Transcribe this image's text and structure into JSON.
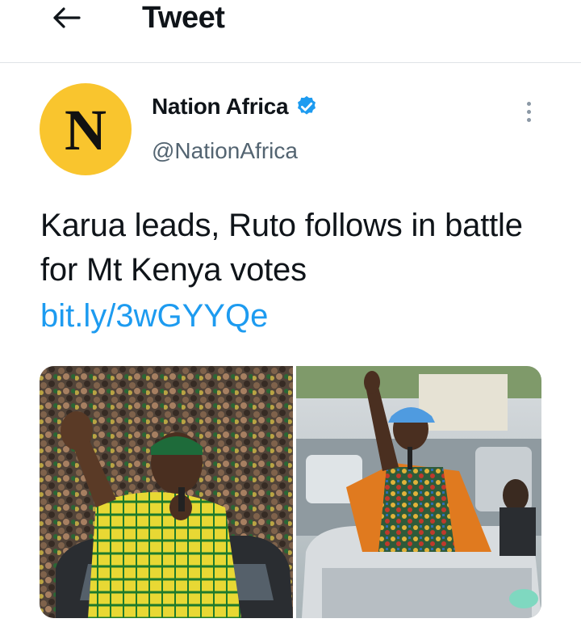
{
  "header": {
    "title": "Tweet",
    "back_icon": "arrow-left-icon"
  },
  "author": {
    "name": "Nation Africa",
    "handle": "@NationAfrica",
    "avatar_letter": "N",
    "avatar_color": "#f9c52e",
    "verified": true,
    "verified_color": "#1d9bf0"
  },
  "tweet": {
    "text": "Karua leads, Ruto follows in battle for Mt Kenya votes",
    "link": "bit.ly/3wGYYQe",
    "link_color": "#1d9bf0"
  },
  "media": {
    "type": "photo-collage",
    "panels": [
      "left-rally-photo",
      "right-rally-photo"
    ]
  }
}
